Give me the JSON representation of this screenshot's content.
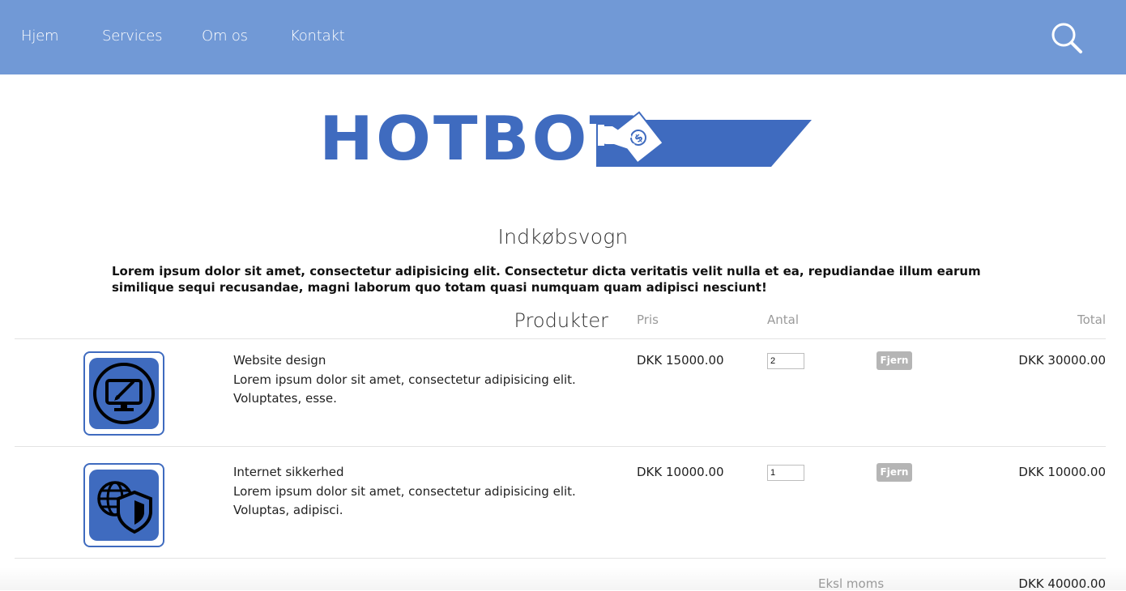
{
  "nav": {
    "items": [
      {
        "label": "Hjem"
      },
      {
        "label": "Services"
      },
      {
        "label": "Om os"
      },
      {
        "label": "Kontakt"
      }
    ],
    "search_icon": "search-icon"
  },
  "logo": {
    "text": "HOTBOT",
    "mark_icon": "hand-with-money-icon",
    "color": "#3f6bbf"
  },
  "cart": {
    "title": "Indkøbsvogn",
    "intro": "Lorem ipsum dolor sit amet, consectetur adipisicing elit. Consectetur dicta veritatis velit nulla et ea, repudiandae illum earum similique sequi recusandae, magni laborum quo totam quasi numquam quam adipisci nesciunt!",
    "headers": {
      "products": "Produkter",
      "price": "Pris",
      "quantity": "Antal",
      "total": "Total"
    },
    "items": [
      {
        "name": "Website design",
        "description": "Lorem ipsum dolor sit amet, consectetur adipisicing elit. Voluptates, esse.",
        "price": "DKK 15000.00",
        "quantity": "2",
        "remove_label": "Fjern",
        "total": "DKK 30000.00",
        "icon": "monitor-pen-icon"
      },
      {
        "name": "Internet sikkerhed",
        "description": "Lorem ipsum dolor sit amet, consectetur adipisicing elit. Voluptas, adipisci.",
        "price": "DKK 10000.00",
        "quantity": "1",
        "remove_label": "Fjern",
        "total": "DKK 10000.00",
        "icon": "globe-shield-icon"
      }
    ],
    "summary": {
      "label": "Eksl moms",
      "value": "DKK 40000.00"
    }
  },
  "colors": {
    "nav_bg": "#7199d6",
    "brand_blue": "#3f6bbf",
    "button_grey": "#b5b5b5"
  }
}
